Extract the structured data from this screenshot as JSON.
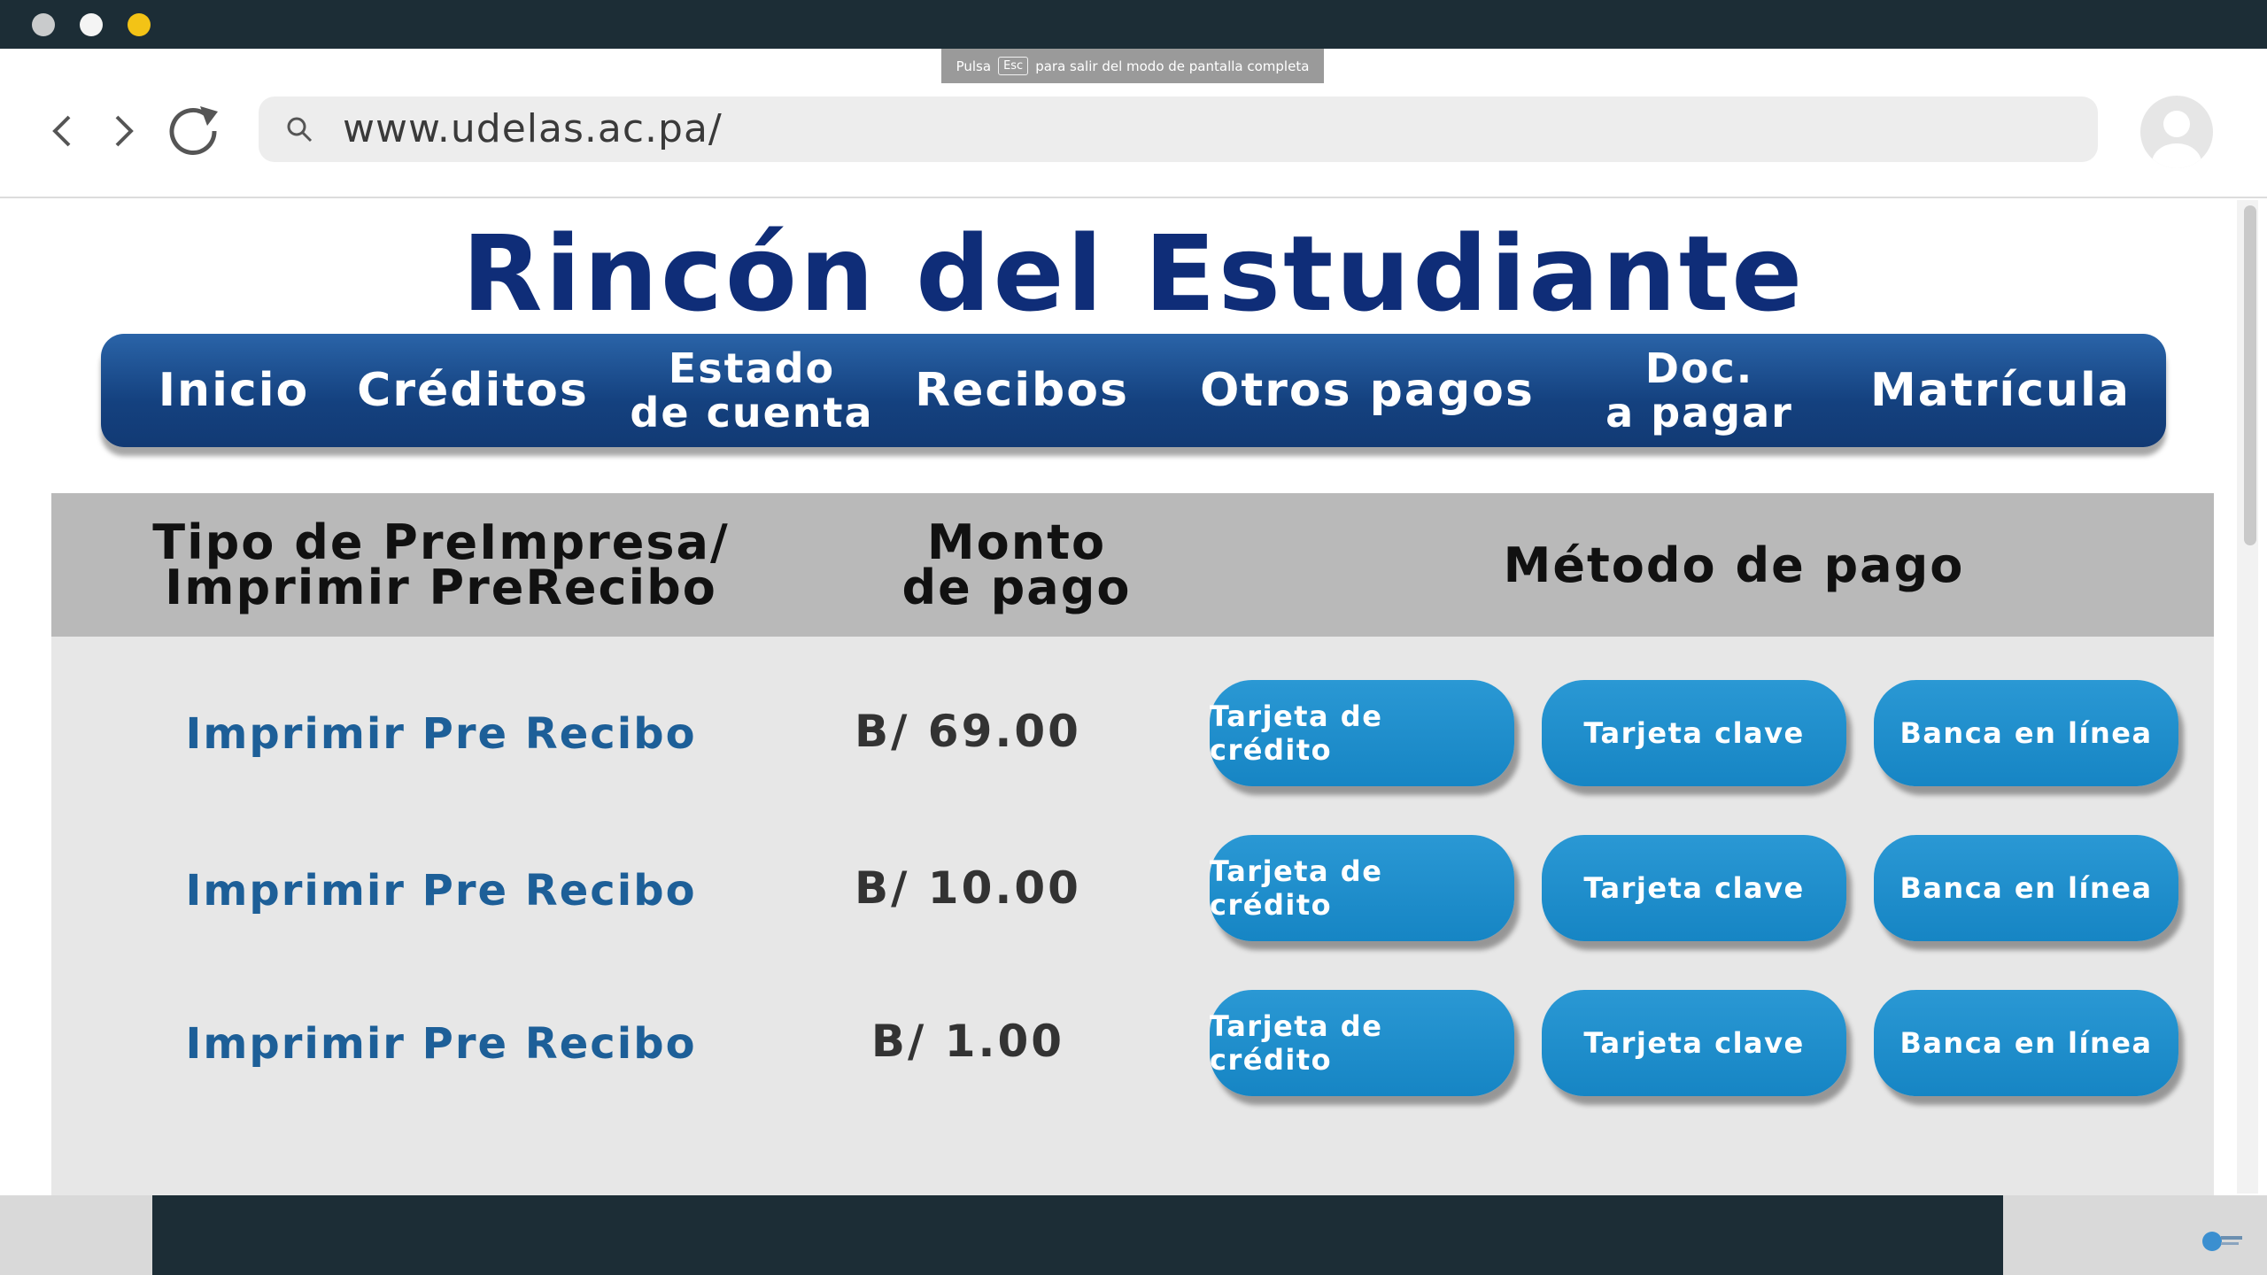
{
  "toast": {
    "pre": "Pulsa",
    "key": "Esc",
    "post": "para salir del modo de pantalla completa"
  },
  "browser": {
    "url": "www.udelas.ac.pa/"
  },
  "page": {
    "title": "Rincón del Estudiante"
  },
  "menu": [
    {
      "line1": "Inicio",
      "line2": ""
    },
    {
      "line1": "Créditos",
      "line2": ""
    },
    {
      "line1": "Estado",
      "line2": "de cuenta"
    },
    {
      "line1": "Recibos",
      "line2": ""
    },
    {
      "line1": "Otros pagos",
      "line2": ""
    },
    {
      "line1": "Doc.",
      "line2": "a pagar"
    },
    {
      "line1": "Matrícula",
      "line2": ""
    }
  ],
  "table": {
    "headers": {
      "type_line1": "Tipo de PreImpresa/",
      "type_line2": "Imprimir PreRecibo",
      "amount_line1": "Monto",
      "amount_line2": "de pago",
      "method": "Método de pago"
    },
    "rows": [
      {
        "label": "Imprimir Pre Recibo",
        "amount": "B/ 69.00",
        "buttons": [
          "Tarjeta de crédito",
          "Tarjeta clave",
          "Banca en línea"
        ]
      },
      {
        "label": "Imprimir Pre Recibo",
        "amount": "B/ 10.00",
        "buttons": [
          "Tarjeta de crédito",
          "Tarjeta clave",
          "Banca en línea"
        ]
      },
      {
        "label": "Imprimir Pre Recibo",
        "amount": "B/ 1.00",
        "buttons": [
          "Tarjeta de crédito",
          "Tarjeta clave",
          "Banca en línea"
        ]
      }
    ]
  },
  "colors": {
    "title": "#0f2d78",
    "menu": "#14417f",
    "button": "#1685c4",
    "row_label": "#1d5f98"
  }
}
